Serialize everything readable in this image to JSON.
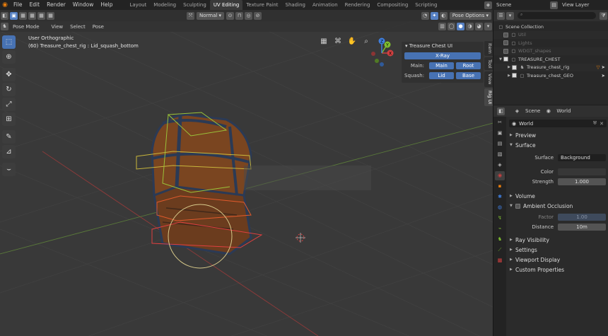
{
  "topbar": {
    "menus": [
      "File",
      "Edit",
      "Render",
      "Window",
      "Help"
    ],
    "workspaces": [
      "Layout",
      "Modeling",
      "Sculpting",
      "UV Editing",
      "Texture Paint",
      "Shading",
      "Animation",
      "Rendering",
      "Compositing",
      "Scripting"
    ],
    "active_workspace": "UV Editing",
    "scene": "Scene",
    "view_layer": "View Layer"
  },
  "viewport": {
    "mode": "Pose Mode",
    "menu": [
      "View",
      "Select",
      "Pose"
    ],
    "orientation": "Normal",
    "pose_options": "Pose Options",
    "view_name": "User Orthographic",
    "active_info": "(60) Treasure_chest_rig : Lid_squash_bottom"
  },
  "npanel": {
    "title": "Treasure Chest UI",
    "xray": "X-Ray",
    "main_label": "Main:",
    "main_btn1": "Main",
    "main_btn2": "Root",
    "squash_label": "Squash:",
    "squash_btn1": "Lid",
    "squash_btn2": "Base",
    "tabs": [
      "Item",
      "Tool",
      "View",
      "Rig UI"
    ]
  },
  "gizmo": {
    "x": "X",
    "y": "Y",
    "z": "Z"
  },
  "outliner": {
    "root": "Scene Collection",
    "items": [
      {
        "name": "Util",
        "dim": true
      },
      {
        "name": "Lights",
        "dim": true
      },
      {
        "name": "WDGT_shapes",
        "dim": true
      },
      {
        "name": "TREASURE_CHEST",
        "dim": false
      },
      {
        "name": "Treasure_chest_rig",
        "dim": false
      },
      {
        "name": "Treasure_chest_GEO",
        "dim": false
      }
    ]
  },
  "properties": {
    "header_scene": "Scene",
    "header_world": "World",
    "world_name": "World",
    "preview": "Preview",
    "surface": "Surface",
    "surface_label": "Surface",
    "surface_value": "Background",
    "color_label": "Color",
    "strength_label": "Strength",
    "strength_value": "1.000",
    "volume": "Volume",
    "ambient_occlusion": "Ambient Occlusion",
    "factor_label": "Factor",
    "factor_value": "1.00",
    "distance_label": "Distance",
    "distance_value": "10m",
    "ray_visibility": "Ray Visibility",
    "settings": "Settings",
    "viewport_display": "Viewport Display",
    "custom_properties": "Custom Properties"
  }
}
